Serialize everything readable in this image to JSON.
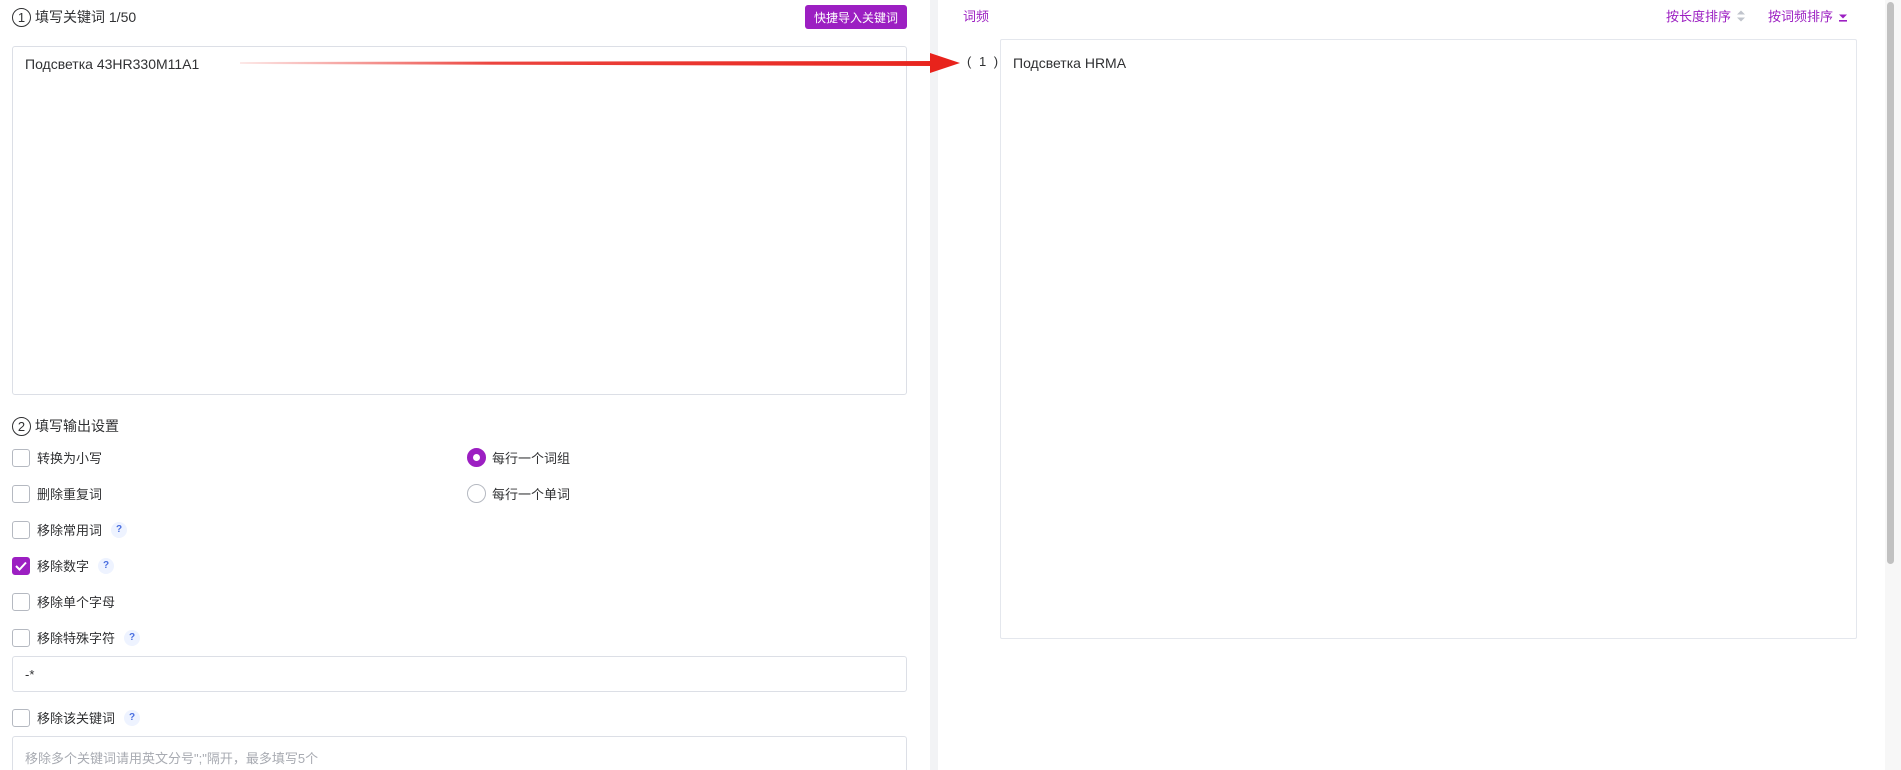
{
  "left_panel": {
    "step1": {
      "number": "1",
      "title": "填写关键词 1/50"
    },
    "quick_import_label": "快捷导入关键词",
    "keyword_input": "Подсветка 43HR330M11A1",
    "step2": {
      "number": "2",
      "title": "填写输出设置"
    },
    "options": {
      "lowercase": {
        "label": "转换为小写",
        "checked": false
      },
      "remove_duplicates": {
        "label": "删除重复词",
        "checked": false
      },
      "remove_common": {
        "label": "移除常用词",
        "checked": false,
        "help": "?"
      },
      "remove_numbers": {
        "label": "移除数字",
        "checked": true,
        "help": "?"
      },
      "remove_single_letter": {
        "label": "移除单个字母",
        "checked": false
      },
      "remove_special": {
        "label": "移除特殊字符",
        "checked": false,
        "help": "?"
      },
      "remove_keyword": {
        "label": "移除该关键词",
        "checked": false,
        "help": "?"
      }
    },
    "radio_options": {
      "phrase_per_line": {
        "label": "每行一个词组",
        "selected": true
      },
      "word_per_line": {
        "label": "每行一个单词",
        "selected": false
      }
    },
    "special_chars_value": "-*",
    "remove_keywords_placeholder": "移除多个关键词请用英文分号\";\"隔开，最多填写5个"
  },
  "right_panel": {
    "freq_label": "词频",
    "sort_by_length": "按长度排序",
    "sort_by_frequency": "按词频排序",
    "results": [
      {
        "index": "( 1 )",
        "text": "Подсветка HRMA"
      }
    ]
  },
  "colors": {
    "accent": "#9c1fc2",
    "arrow": "#e8231c",
    "border": "#dcdfe6",
    "help_bg": "#eef3ff",
    "help_fg": "#4a6ee0"
  }
}
